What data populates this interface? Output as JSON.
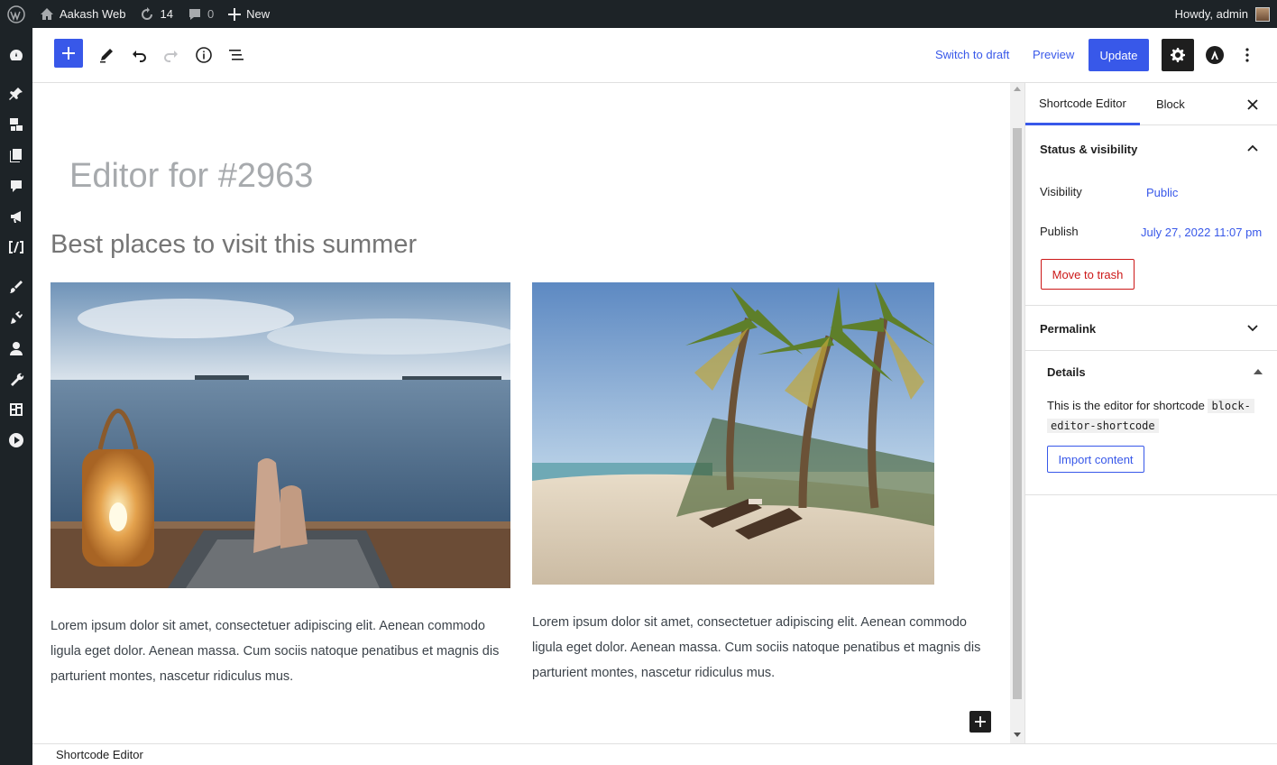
{
  "adminbar": {
    "site_name": "Aakash Web",
    "updates_count": "14",
    "comments_count": "0",
    "new_label": "New",
    "greeting": "Howdy, admin"
  },
  "adminmenu": {
    "items": [
      "dashboard-icon",
      "pin-icon",
      "media-icon",
      "pages-icon",
      "comments-icon",
      "megaphone-icon",
      "shortcode-icon",
      "appearance-icon",
      "plugins-icon",
      "users-icon",
      "tools-icon",
      "settings-icon",
      "play-icon"
    ]
  },
  "toolbar": {
    "switch_to_draft": "Switch to draft",
    "preview": "Preview",
    "update": "Update"
  },
  "canvas": {
    "post_title": "Editor for #2963",
    "heading": "Best places to visit this summer",
    "para1": "Lorem ipsum dolor sit amet, consectetuer adipiscing elit. Aenean commodo ligula eget dolor. Aenean massa. Cum sociis natoque penatibus et magnis dis parturient montes, nascetur ridiculus mus.",
    "para2": "Lorem ipsum dolor sit amet, consectetuer adipiscing elit. Aenean commodo ligula eget dolor. Aenean massa. Cum sociis natoque penatibus et magnis dis parturient montes, nascetur ridiculus mus."
  },
  "sidebar": {
    "tab_shortcode": "Shortcode Editor",
    "tab_block": "Block",
    "status_visibility": "Status & visibility",
    "visibility_label": "Visibility",
    "visibility_value": "Public",
    "publish_label": "Publish",
    "publish_value": "July 27, 2022 11:07 pm",
    "move_to_trash": "Move to trash",
    "permalink": "Permalink",
    "details": "Details",
    "details_text": "This is the editor for shortcode",
    "details_code_1": "block-",
    "details_code_2": "editor-shortcode",
    "import_content": "Import content"
  },
  "footer": {
    "breadcrumb": "Shortcode Editor"
  },
  "colors": {
    "accent": "#3858e9",
    "admin_bg": "#1d2327",
    "danger": "#cc1818"
  }
}
